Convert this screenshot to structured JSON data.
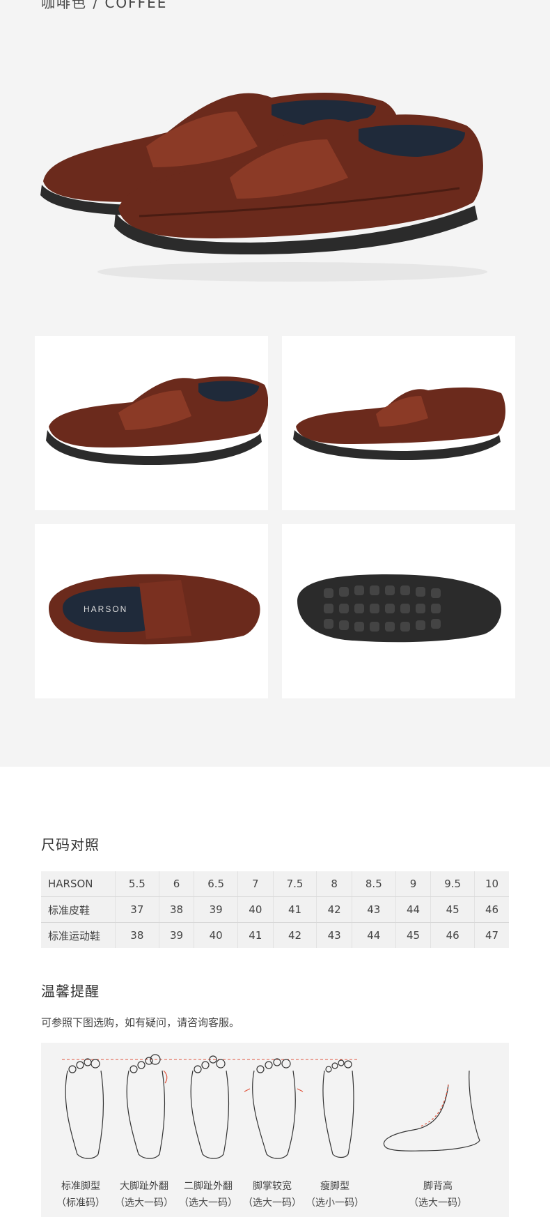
{
  "color_label": "咖啡色 / COFFEE",
  "brand_on_insole": "HARSON",
  "size_section": {
    "title": "尺码对照",
    "rows": [
      {
        "label": "HARSON",
        "values": [
          "5.5",
          "6",
          "6.5",
          "7",
          "7.5",
          "8",
          "8.5",
          "9",
          "9.5",
          "10"
        ]
      },
      {
        "label": "标准皮鞋",
        "values": [
          "37",
          "38",
          "39",
          "40",
          "41",
          "42",
          "43",
          "44",
          "45",
          "46"
        ]
      },
      {
        "label": "标准运动鞋",
        "values": [
          "38",
          "39",
          "40",
          "41",
          "42",
          "43",
          "44",
          "45",
          "46",
          "47"
        ]
      }
    ]
  },
  "tips_section": {
    "title": "温馨提醒",
    "note": "可参照下图选购，如有疑问，请咨询客服。",
    "feet": [
      {
        "name": "标准脚型",
        "advice": "（标准码）"
      },
      {
        "name": "大脚趾外翻",
        "advice": "（选大一码）"
      },
      {
        "name": "二脚趾外翻",
        "advice": "（选大一码）"
      },
      {
        "name": "脚掌较宽",
        "advice": "（选大一码）"
      },
      {
        "name": "瘦脚型",
        "advice": "（选小一码）"
      },
      {
        "name": "脚背高",
        "advice": "（选大一码）"
      }
    ]
  },
  "colors": {
    "leather": "#6b2a1c",
    "leather_light": "#8b3a26",
    "sole": "#2b2b2b",
    "panel_gray": "#f4f4f4",
    "accent_red": "#e0533c"
  }
}
